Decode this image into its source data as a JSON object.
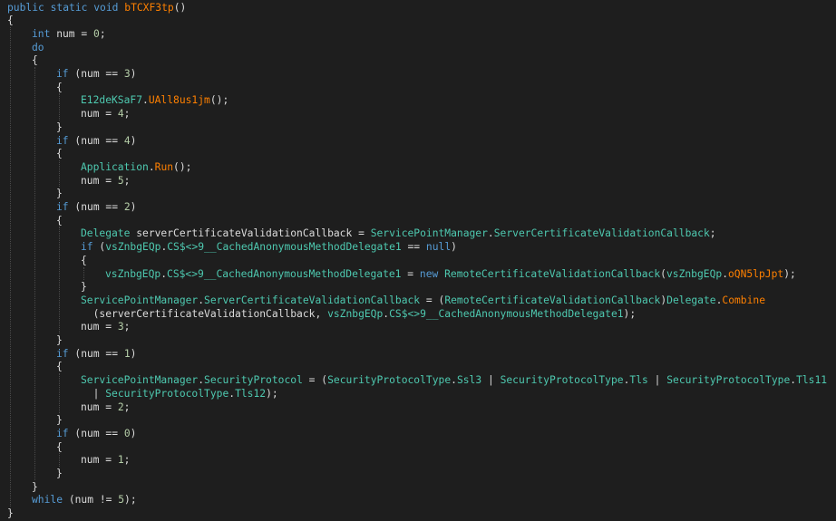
{
  "window": {
    "background": "#1e1e1e"
  },
  "theme": {
    "keyword": "#569cd6",
    "type": "#4ec9b0",
    "method_highlight": "#dcdcaa",
    "member_highlight": "#ff8000",
    "number": "#b5cea8",
    "plain_text": "#dcdcdc",
    "indent_guide": "#4a4a4a"
  },
  "code": {
    "lines": [
      {
        "indent": 0,
        "tokens": [
          {
            "t": "public",
            "c": "kw"
          },
          {
            "t": " ",
            "c": "pl"
          },
          {
            "t": "static",
            "c": "kw"
          },
          {
            "t": " ",
            "c": "pl"
          },
          {
            "t": "void",
            "c": "kw"
          },
          {
            "t": " ",
            "c": "pl"
          },
          {
            "t": "bTCXF3tp",
            "c": "mm"
          },
          {
            "t": "()",
            "c": "pl"
          }
        ]
      },
      {
        "indent": 0,
        "tokens": [
          {
            "t": "{",
            "c": "pl"
          }
        ]
      },
      {
        "indent": 1,
        "tokens": [
          {
            "t": "int",
            "c": "kw"
          },
          {
            "t": " num = ",
            "c": "pl"
          },
          {
            "t": "0",
            "c": "nu"
          },
          {
            "t": ";",
            "c": "pl"
          }
        ]
      },
      {
        "indent": 1,
        "tokens": [
          {
            "t": "do",
            "c": "kw"
          }
        ]
      },
      {
        "indent": 1,
        "tokens": [
          {
            "t": "{",
            "c": "pl"
          }
        ]
      },
      {
        "indent": 2,
        "tokens": [
          {
            "t": "if",
            "c": "kw"
          },
          {
            "t": " (num == ",
            "c": "pl"
          },
          {
            "t": "3",
            "c": "nu"
          },
          {
            "t": ")",
            "c": "pl"
          }
        ]
      },
      {
        "indent": 2,
        "tokens": [
          {
            "t": "{",
            "c": "pl"
          }
        ]
      },
      {
        "indent": 3,
        "tokens": [
          {
            "t": "E12deKSaF7",
            "c": "ty"
          },
          {
            "t": ".",
            "c": "pl"
          },
          {
            "t": "UAll8us1jm",
            "c": "mm"
          },
          {
            "t": "();",
            "c": "pl"
          }
        ]
      },
      {
        "indent": 3,
        "tokens": [
          {
            "t": "num = ",
            "c": "pl"
          },
          {
            "t": "4",
            "c": "nu"
          },
          {
            "t": ";",
            "c": "pl"
          }
        ]
      },
      {
        "indent": 2,
        "tokens": [
          {
            "t": "}",
            "c": "pl"
          }
        ]
      },
      {
        "indent": 2,
        "tokens": [
          {
            "t": "if",
            "c": "kw"
          },
          {
            "t": " (num == ",
            "c": "pl"
          },
          {
            "t": "4",
            "c": "nu"
          },
          {
            "t": ")",
            "c": "pl"
          }
        ]
      },
      {
        "indent": 2,
        "tokens": [
          {
            "t": "{",
            "c": "pl"
          }
        ]
      },
      {
        "indent": 3,
        "tokens": [
          {
            "t": "Application",
            "c": "ty"
          },
          {
            "t": ".",
            "c": "pl"
          },
          {
            "t": "Run",
            "c": "mm"
          },
          {
            "t": "();",
            "c": "pl"
          }
        ]
      },
      {
        "indent": 3,
        "tokens": [
          {
            "t": "num = ",
            "c": "pl"
          },
          {
            "t": "5",
            "c": "nu"
          },
          {
            "t": ";",
            "c": "pl"
          }
        ]
      },
      {
        "indent": 2,
        "tokens": [
          {
            "t": "}",
            "c": "pl"
          }
        ]
      },
      {
        "indent": 2,
        "tokens": [
          {
            "t": "if",
            "c": "kw"
          },
          {
            "t": " (num == ",
            "c": "pl"
          },
          {
            "t": "2",
            "c": "nu"
          },
          {
            "t": ")",
            "c": "pl"
          }
        ]
      },
      {
        "indent": 2,
        "tokens": [
          {
            "t": "{",
            "c": "pl"
          }
        ]
      },
      {
        "indent": 3,
        "tokens": [
          {
            "t": "Delegate",
            "c": "ty"
          },
          {
            "t": " serverCertificateValidationCallback = ",
            "c": "pl"
          },
          {
            "t": "ServicePointManager",
            "c": "ty"
          },
          {
            "t": ".",
            "c": "pl"
          },
          {
            "t": "ServerCertificateValidationCallback",
            "c": "ty"
          },
          {
            "t": ";",
            "c": "pl"
          }
        ]
      },
      {
        "indent": 3,
        "tokens": [
          {
            "t": "if",
            "c": "kw"
          },
          {
            "t": " (",
            "c": "pl"
          },
          {
            "t": "vsZnbgEQp",
            "c": "ty"
          },
          {
            "t": ".",
            "c": "pl"
          },
          {
            "t": "CS$<>9__CachedAnonymousMethodDelegate1",
            "c": "ty"
          },
          {
            "t": " == ",
            "c": "pl"
          },
          {
            "t": "null",
            "c": "kw"
          },
          {
            "t": ")",
            "c": "pl"
          }
        ]
      },
      {
        "indent": 3,
        "tokens": [
          {
            "t": "{",
            "c": "pl"
          }
        ]
      },
      {
        "indent": 4,
        "tokens": [
          {
            "t": "vsZnbgEQp",
            "c": "ty"
          },
          {
            "t": ".",
            "c": "pl"
          },
          {
            "t": "CS$<>9__CachedAnonymousMethodDelegate1",
            "c": "ty"
          },
          {
            "t": " = ",
            "c": "pl"
          },
          {
            "t": "new",
            "c": "kw"
          },
          {
            "t": " ",
            "c": "pl"
          },
          {
            "t": "RemoteCertificateValidationCallback",
            "c": "ty"
          },
          {
            "t": "(",
            "c": "pl"
          },
          {
            "t": "vsZnbgEQp",
            "c": "ty"
          },
          {
            "t": ".",
            "c": "pl"
          },
          {
            "t": "oQN5lpJpt",
            "c": "mm"
          },
          {
            "t": ");",
            "c": "pl"
          }
        ]
      },
      {
        "indent": 3,
        "tokens": [
          {
            "t": "}",
            "c": "pl"
          }
        ]
      },
      {
        "indent": 3,
        "tokens": [
          {
            "t": "ServicePointManager",
            "c": "ty"
          },
          {
            "t": ".",
            "c": "pl"
          },
          {
            "t": "ServerCertificateValidationCallback",
            "c": "ty"
          },
          {
            "t": " = (",
            "c": "pl"
          },
          {
            "t": "RemoteCertificateValidationCallback",
            "c": "ty"
          },
          {
            "t": ")",
            "c": "pl"
          },
          {
            "t": "Delegate",
            "c": "ty"
          },
          {
            "t": ".",
            "c": "pl"
          },
          {
            "t": "Combine",
            "c": "mm"
          }
        ]
      },
      {
        "indent": 3,
        "extra": "  ",
        "tokens": [
          {
            "t": "(serverCertificateValidationCallback, ",
            "c": "pl"
          },
          {
            "t": "vsZnbgEQp",
            "c": "ty"
          },
          {
            "t": ".",
            "c": "pl"
          },
          {
            "t": "CS$<>9__CachedAnonymousMethodDelegate1",
            "c": "ty"
          },
          {
            "t": ");",
            "c": "pl"
          }
        ]
      },
      {
        "indent": 3,
        "tokens": [
          {
            "t": "num = ",
            "c": "pl"
          },
          {
            "t": "3",
            "c": "nu"
          },
          {
            "t": ";",
            "c": "pl"
          }
        ]
      },
      {
        "indent": 2,
        "tokens": [
          {
            "t": "}",
            "c": "pl"
          }
        ]
      },
      {
        "indent": 2,
        "tokens": [
          {
            "t": "if",
            "c": "kw"
          },
          {
            "t": " (num == ",
            "c": "pl"
          },
          {
            "t": "1",
            "c": "nu"
          },
          {
            "t": ")",
            "c": "pl"
          }
        ]
      },
      {
        "indent": 2,
        "tokens": [
          {
            "t": "{",
            "c": "pl"
          }
        ]
      },
      {
        "indent": 3,
        "tokens": [
          {
            "t": "ServicePointManager",
            "c": "ty"
          },
          {
            "t": ".",
            "c": "pl"
          },
          {
            "t": "SecurityProtocol",
            "c": "ty"
          },
          {
            "t": " = (",
            "c": "pl"
          },
          {
            "t": "SecurityProtocolType",
            "c": "ty"
          },
          {
            "t": ".",
            "c": "pl"
          },
          {
            "t": "Ssl3",
            "c": "ty"
          },
          {
            "t": " | ",
            "c": "pl"
          },
          {
            "t": "SecurityProtocolType",
            "c": "ty"
          },
          {
            "t": ".",
            "c": "pl"
          },
          {
            "t": "Tls",
            "c": "ty"
          },
          {
            "t": " | ",
            "c": "pl"
          },
          {
            "t": "SecurityProtocolType",
            "c": "ty"
          },
          {
            "t": ".",
            "c": "pl"
          },
          {
            "t": "Tls11",
            "c": "ty"
          }
        ]
      },
      {
        "indent": 3,
        "extra": "  ",
        "tokens": [
          {
            "t": "| ",
            "c": "pl"
          },
          {
            "t": "SecurityProtocolType",
            "c": "ty"
          },
          {
            "t": ".",
            "c": "pl"
          },
          {
            "t": "Tls12",
            "c": "ty"
          },
          {
            "t": ");",
            "c": "pl"
          }
        ]
      },
      {
        "indent": 3,
        "tokens": [
          {
            "t": "num = ",
            "c": "pl"
          },
          {
            "t": "2",
            "c": "nu"
          },
          {
            "t": ";",
            "c": "pl"
          }
        ]
      },
      {
        "indent": 2,
        "tokens": [
          {
            "t": "}",
            "c": "pl"
          }
        ]
      },
      {
        "indent": 2,
        "tokens": [
          {
            "t": "if",
            "c": "kw"
          },
          {
            "t": " (num == ",
            "c": "pl"
          },
          {
            "t": "0",
            "c": "nu"
          },
          {
            "t": ")",
            "c": "pl"
          }
        ]
      },
      {
        "indent": 2,
        "tokens": [
          {
            "t": "{",
            "c": "pl"
          }
        ]
      },
      {
        "indent": 3,
        "tokens": [
          {
            "t": "num = ",
            "c": "pl"
          },
          {
            "t": "1",
            "c": "nu"
          },
          {
            "t": ";",
            "c": "pl"
          }
        ]
      },
      {
        "indent": 2,
        "tokens": [
          {
            "t": "}",
            "c": "pl"
          }
        ]
      },
      {
        "indent": 1,
        "tokens": [
          {
            "t": "}",
            "c": "pl"
          }
        ]
      },
      {
        "indent": 1,
        "tokens": [
          {
            "t": "while",
            "c": "kw"
          },
          {
            "t": " (num != ",
            "c": "pl"
          },
          {
            "t": "5",
            "c": "nu"
          },
          {
            "t": ");",
            "c": "pl"
          }
        ]
      },
      {
        "indent": 0,
        "tokens": [
          {
            "t": "}",
            "c": "pl"
          }
        ]
      }
    ]
  }
}
